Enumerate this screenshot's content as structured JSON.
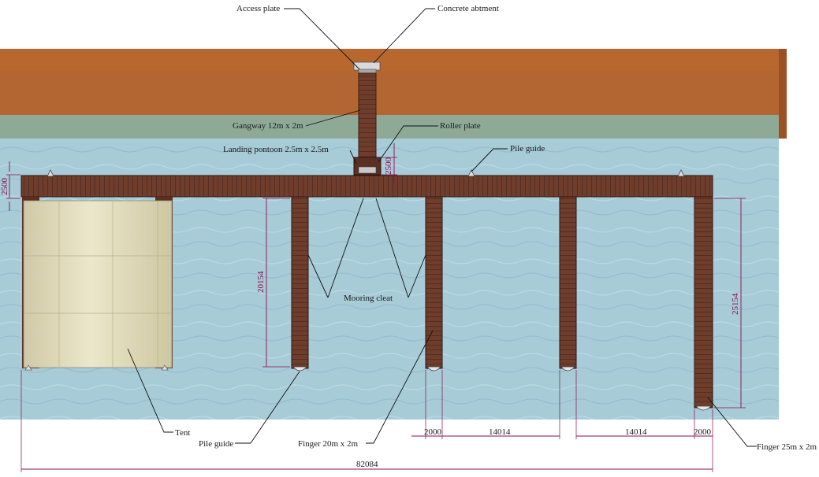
{
  "labels": {
    "access_plate": "Access plate",
    "concrete_abutment": "Concrete abtment",
    "gangway": "Gangway 12m x 2m",
    "roller_plate": "Roller plate",
    "landing_pontoon": "Landing pontoon 2.5m x 2.5m",
    "pile_guide_top": "Pile guide",
    "mooring_cleat": "Mooring cleat",
    "tent": "Tent",
    "pile_guide_bottom": "Pile guide",
    "finger_20": "Finger 20m x 2m",
    "finger_25": "Finger 25m x 2m"
  },
  "dimensions": {
    "main_pontoon_width": "2500",
    "landing_pontoon_depth": "2500",
    "finger_20_length": "20154",
    "finger_25_length": "25154",
    "finger_width_left": "2000",
    "spacing_left": "14014",
    "spacing_right": "14014",
    "finger_width_right": "2000",
    "overall_length": "82084"
  },
  "colors": {
    "land": "#b5642e",
    "land_dark": "#8e4d22",
    "bank": "#8da896",
    "water": "#a6cbd6",
    "deck": "#6a3a2a",
    "deck_plank": "#4a271c",
    "tent": "#d8d2b0",
    "dimension": "#8a1050"
  }
}
